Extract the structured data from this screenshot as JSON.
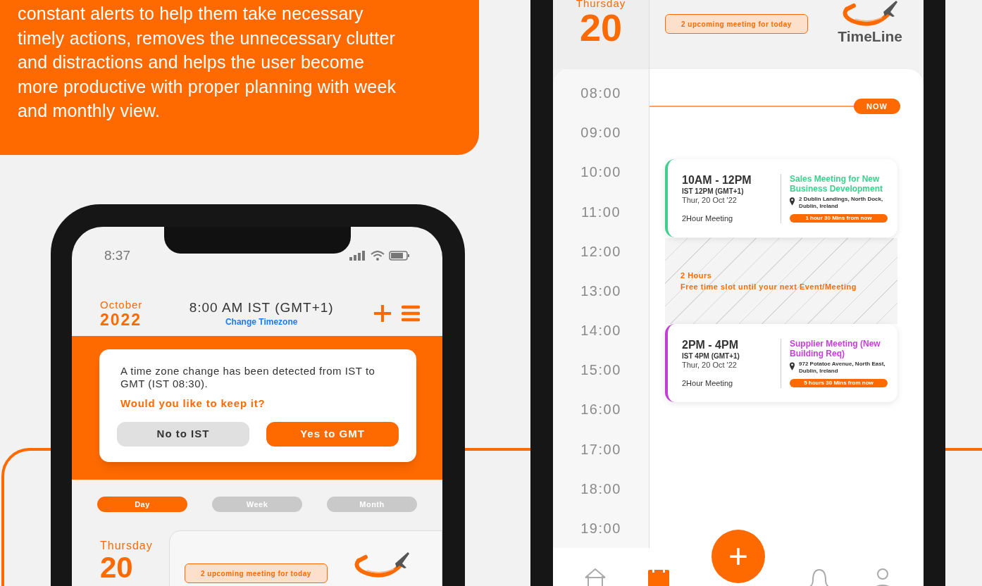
{
  "intro": {
    "text": "constant alerts to help them take necessary timely actions, removes the unnecessary clutter and distractions and helps the user become more productive with proper planning with week and monthly view."
  },
  "phone_left": {
    "status_time": "8:37",
    "header": {
      "month": "October",
      "year": "2022",
      "current_time": "8:00 AM IST (GMT+1)",
      "change_timezone": "Change Timezone"
    },
    "alert": {
      "message": "A time zone change has been detected from IST to GMT (IST 08:30).",
      "question": "Would you like to keep it?",
      "buttons": [
        {
          "label": "No to IST",
          "kind": "secondary"
        },
        {
          "label": "Yes to GMT",
          "kind": "primary"
        }
      ]
    },
    "view_tabs": [
      {
        "label": "Day",
        "selected": true
      },
      {
        "label": "Week",
        "selected": false
      },
      {
        "label": "Month",
        "selected": false
      }
    ],
    "day": {
      "weekday": "Thursday",
      "date": "20",
      "badge": "2 upcoming meeting for today"
    }
  },
  "phone_right": {
    "day": {
      "weekday": "Thursday",
      "date": "20",
      "badge": "2 upcoming meeting for today"
    },
    "logo": {
      "text": "TimeLine"
    },
    "hours": [
      "08:00",
      "09:00",
      "10:00",
      "11:00",
      "12:00",
      "13:00",
      "14:00",
      "15:00",
      "16:00",
      "17:00",
      "18:00",
      "19:00"
    ],
    "now_label": "NOW",
    "events": [
      {
        "time_range": "10AM - 12PM",
        "alt_time": "IST 12PM (GMT+1)",
        "date": "Thur, 20 Oct '22",
        "duration": "2Hour Meeting",
        "title": "Sales Meeting for New Business Development",
        "location": "2 Dublin Landings, North Dock, Dublin, Ireland",
        "countdown": "1 hour 30 Mins from now",
        "color": "#3ecf8e"
      },
      {
        "time_range": "2PM - 4PM",
        "alt_time": "IST 4PM (GMT+1)",
        "date": "Thur, 20 Oct '22",
        "duration": "2Hour Meeting",
        "title": "Supplier Meeting (New Building Req)",
        "location": "972 Potatoe Avenue, North East, Dublin, Ireland",
        "countdown": "5 hours 30 Mins from now",
        "color": "#c23fd6"
      }
    ],
    "free_slot": {
      "duration": "2 Hours",
      "text": "Free time slot until your next Event/Meeting"
    },
    "fab": "+",
    "nav": [
      {
        "kind": "home",
        "selected": false
      },
      {
        "kind": "calendar",
        "selected": true
      },
      {
        "kind": "notifications",
        "selected": false
      },
      {
        "kind": "profile",
        "selected": false
      }
    ]
  }
}
